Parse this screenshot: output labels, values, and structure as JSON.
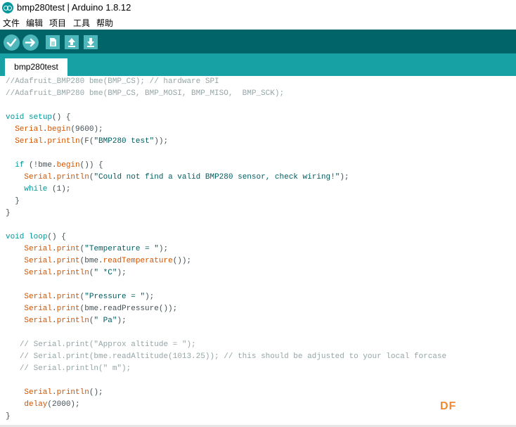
{
  "window": {
    "title": "bmp280test | Arduino 1.8.12"
  },
  "menu": [
    "文件",
    "编辑",
    "项目",
    "工具",
    "帮助"
  ],
  "toolbar": {
    "icons": [
      "verify-icon",
      "upload-icon",
      "new-icon",
      "open-icon",
      "save-icon"
    ]
  },
  "tabs": [
    "bmp280test"
  ],
  "code": [
    [
      [
        "cmt",
        "//Adafruit_BMP280 bme(BMP_CS); // hardware SPI"
      ]
    ],
    [
      [
        "cmt",
        "//Adafruit_BMP280 bme(BMP_CS, BMP_MOSI, BMP_MISO,  BMP_SCK);"
      ]
    ],
    [],
    [
      [
        "kw",
        "void"
      ],
      [
        "",
        " "
      ],
      [
        "kw",
        "setup"
      ],
      [
        "",
        "() {"
      ]
    ],
    [
      [
        "",
        "  "
      ],
      [
        "fn",
        "Serial"
      ],
      [
        "",
        "."
      ],
      [
        "fn",
        "begin"
      ],
      [
        "",
        "(9600);"
      ]
    ],
    [
      [
        "",
        "  "
      ],
      [
        "fn",
        "Serial"
      ],
      [
        "",
        "."
      ],
      [
        "fn",
        "println"
      ],
      [
        "",
        "(F("
      ],
      [
        "str",
        "\"BMP280 test\""
      ],
      [
        "",
        "));"
      ]
    ],
    [],
    [
      [
        "",
        "  "
      ],
      [
        "kw",
        "if"
      ],
      [
        "",
        " (!bme."
      ],
      [
        "fn",
        "begin"
      ],
      [
        "",
        "()) {"
      ]
    ],
    [
      [
        "",
        "    "
      ],
      [
        "fn",
        "Serial"
      ],
      [
        "",
        "."
      ],
      [
        "fn",
        "println"
      ],
      [
        "",
        "("
      ],
      [
        "str",
        "\"Could not find a valid BMP280 sensor, check wiring!\""
      ],
      [
        "",
        ");"
      ]
    ],
    [
      [
        "",
        "    "
      ],
      [
        "kw",
        "while"
      ],
      [
        "",
        " (1);"
      ]
    ],
    [
      [
        "",
        "  }"
      ]
    ],
    [
      [
        "",
        "}"
      ]
    ],
    [],
    [
      [
        "kw",
        "void"
      ],
      [
        "",
        " "
      ],
      [
        "kw",
        "loop"
      ],
      [
        "",
        "() {"
      ]
    ],
    [
      [
        "",
        "    "
      ],
      [
        "fn",
        "Serial"
      ],
      [
        "",
        "."
      ],
      [
        "fn",
        "print"
      ],
      [
        "",
        "("
      ],
      [
        "str",
        "\"Temperature = \""
      ],
      [
        "",
        ");"
      ]
    ],
    [
      [
        "",
        "    "
      ],
      [
        "fn",
        "Serial"
      ],
      [
        "",
        "."
      ],
      [
        "fn",
        "print"
      ],
      [
        "",
        "(bme."
      ],
      [
        "fn",
        "readTemperature"
      ],
      [
        "",
        "());"
      ]
    ],
    [
      [
        "",
        "    "
      ],
      [
        "fn",
        "Serial"
      ],
      [
        "",
        "."
      ],
      [
        "fn",
        "println"
      ],
      [
        "",
        "("
      ],
      [
        "str",
        "\" *C\""
      ],
      [
        "",
        ");"
      ]
    ],
    [],
    [
      [
        "",
        "    "
      ],
      [
        "fn",
        "Serial"
      ],
      [
        "",
        "."
      ],
      [
        "fn",
        "print"
      ],
      [
        "",
        "("
      ],
      [
        "str",
        "\"Pressure = \""
      ],
      [
        "",
        ");"
      ]
    ],
    [
      [
        "",
        "    "
      ],
      [
        "fn",
        "Serial"
      ],
      [
        "",
        "."
      ],
      [
        "fn",
        "print"
      ],
      [
        "",
        "(bme.readPressure());"
      ]
    ],
    [
      [
        "",
        "    "
      ],
      [
        "fn",
        "Serial"
      ],
      [
        "",
        "."
      ],
      [
        "fn",
        "println"
      ],
      [
        "",
        "("
      ],
      [
        "str",
        "\" Pa\""
      ],
      [
        "",
        ");"
      ]
    ],
    [],
    [
      [
        "",
        "   "
      ],
      [
        "cmt",
        "// Serial.print(\"Approx altitude = \");"
      ]
    ],
    [
      [
        "",
        "   "
      ],
      [
        "cmt",
        "// Serial.print(bme.readAltitude(1013.25)); // this should be adjusted to your local forcase"
      ]
    ],
    [
      [
        "",
        "   "
      ],
      [
        "cmt",
        "// Serial.println(\" m\");"
      ]
    ],
    [],
    [
      [
        "",
        "    "
      ],
      [
        "fn",
        "Serial"
      ],
      [
        "",
        "."
      ],
      [
        "fn",
        "println"
      ],
      [
        "",
        "();"
      ]
    ],
    [
      [
        "",
        "    "
      ],
      [
        "fn",
        "delay"
      ],
      [
        "",
        "(2000);"
      ]
    ],
    [
      [
        "",
        "}"
      ]
    ]
  ],
  "watermark": "DF",
  "colors": {
    "toolbar": "#006468",
    "tabstrip": "#17a1a5",
    "button": "#4db7bb",
    "keyword": "#00979c",
    "function": "#d35400",
    "comment": "#95a5a6",
    "string": "#005c5f"
  }
}
